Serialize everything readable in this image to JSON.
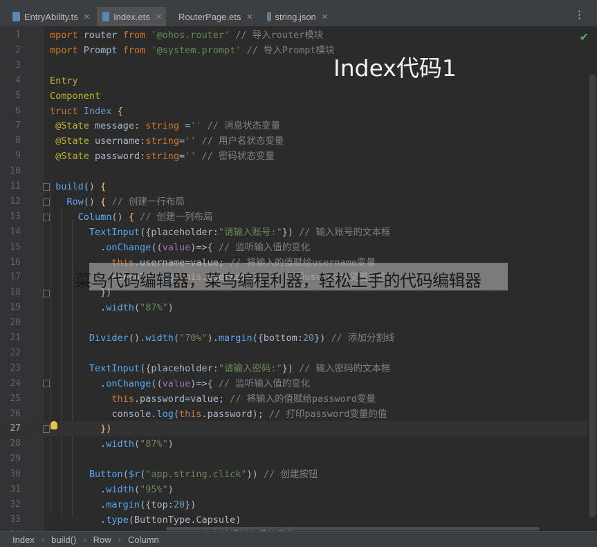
{
  "tabs": [
    {
      "label": "EntryAbility.ts",
      "icon": "typescript-file-icon",
      "active": false
    },
    {
      "label": "Index.ets",
      "icon": "ets-file-icon",
      "active": true
    },
    {
      "label": "RouterPage.ets",
      "icon": "ets-file-icon",
      "active": false
    },
    {
      "label": "string.json",
      "icon": "json-file-icon",
      "active": false
    }
  ],
  "more_menu": "⋮",
  "overlay": {
    "title": "Index代码1",
    "caption": "菜鸟代码编辑器，菜鸟编程利器，轻松上手的代码编辑器"
  },
  "lines": [
    {
      "n": "1",
      "html": "<span class='kw'>mport</span> router <span class='kw'>from</span> <span class='str'>'@ohos.router'</span> <span class='cm'>// 导入router模块</span>"
    },
    {
      "n": "2",
      "html": "<span class='kw'>mport</span> Prompt <span class='kw'>from</span> <span class='str'>'@system.prompt'</span> <span class='cm'>// 导入Prompt模块</span>"
    },
    {
      "n": "3",
      "html": ""
    },
    {
      "n": "4",
      "html": "<span class='ann'>Entry</span>"
    },
    {
      "n": "5",
      "html": "<span class='ann'>Component</span>"
    },
    {
      "n": "6",
      "html": "<span class='kw'>truct</span> <span class='cls'>Index</span> <span class='cn'>{</span>"
    },
    {
      "n": "7",
      "html": " <span class='ann'>@State</span> message: <span class='kw'>string</span> =<span class='str'>''</span> <span class='cm'>// 消息状态变量</span>"
    },
    {
      "n": "8",
      "html": " <span class='ann'>@State</span> username:<span class='kw'>string</span>=<span class='str'>''</span> <span class='cm'>// 用户名状态变量</span>"
    },
    {
      "n": "9",
      "html": " <span class='ann'>@State</span> password:<span class='kw'>string</span>=<span class='str'>''</span> <span class='cm'>// 密码状态变量</span>"
    },
    {
      "n": "10",
      "html": ""
    },
    {
      "n": "11",
      "html": " <span class='fn'>build</span>() <span class='cn'>{</span>"
    },
    {
      "n": "12",
      "html": "   <span class='fn'>Row</span>() <span class='cn'>{</span> <span class='cm'>// 创建一行布局</span>"
    },
    {
      "n": "13",
      "html": "     <span class='fn'>Column</span>() <span class='cn'>{</span> <span class='cm'>// 创建一列布局</span>"
    },
    {
      "n": "14",
      "html": "       <span class='fn'>TextInput</span>({placeholder:<span class='str'>\"请输入账号:\"</span>}) <span class='cm'>// 输入账号的文本框</span>"
    },
    {
      "n": "15",
      "html": "         .<span class='fn'>onChange</span>((<span class='prop'>value</span>)=>{ <span class='cm'>// 监听输入值的变化</span>"
    },
    {
      "n": "16",
      "html": "           <span class='kw'>this</span>.username=value; <span class='cm'>// 将输入的值赋给username变量</span>"
    },
    {
      "n": "17",
      "html": "           console.<span class='fn'>log</span>(<span class='kw'>this</span>.username); <span class='cm'>// 打印username变量的值</span>"
    },
    {
      "n": "18",
      "html": "         })"
    },
    {
      "n": "19",
      "html": "         .<span class='fn'>width</span>(<span class='str'>\"87%\"</span>)"
    },
    {
      "n": "20",
      "html": ""
    },
    {
      "n": "21",
      "html": "       <span class='fn'>Divider</span>().<span class='fn'>width</span>(<span class='str'>\"70%\"</span>).<span class='fn'>margin</span>({bottom:<span class='cls'>20</span>}) <span class='cm'>// 添加分割线</span>"
    },
    {
      "n": "22",
      "html": ""
    },
    {
      "n": "23",
      "html": "       <span class='fn'>TextInput</span>({placeholder:<span class='str'>\"请输入密码:\"</span>}) <span class='cm'>// 输入密码的文本框</span>"
    },
    {
      "n": "24",
      "html": "         .<span class='fn'>onChange</span>((<span class='prop'>value</span>)=>{ <span class='cm'>// 监听输入值的变化</span>"
    },
    {
      "n": "25",
      "html": "           <span class='kw'>this</span>.password=value; <span class='cm'>// 将输入的值赋给password变量</span>"
    },
    {
      "n": "26",
      "html": "           console.<span class='fn'>log</span>(<span class='kw'>this</span>.password); <span class='cm'>// 打印password变量的值</span>"
    },
    {
      "n": "27",
      "html": "         <span class='cn'>})</span>"
    },
    {
      "n": "28",
      "html": "         .<span class='fn'>width</span>(<span class='str'>\"87%\"</span>)"
    },
    {
      "n": "29",
      "html": ""
    },
    {
      "n": "30",
      "html": "       <span class='fn'>Button</span>(<span class='fn'>$r</span>(<span class='str'>\"app.string.click\"</span>)) <span class='cm'>// 创建按钮</span>"
    },
    {
      "n": "31",
      "html": "         .<span class='fn'>width</span>(<span class='str'>\"95%\"</span>)"
    },
    {
      "n": "32",
      "html": "         .<span class='fn'>margin</span>({top:<span class='cls'>20</span>})"
    },
    {
      "n": "33",
      "html": "         .<span class='fn'>type</span>(ButtonType.Capsule)"
    },
    {
      "n": "34",
      "html": "         .<span class='fn'>onClick</span>(()=>{ <span class='cm'>// 点击按钮时执行的事件</span>"
    }
  ],
  "current_line": "27",
  "breadcrumb": [
    "Index",
    "build()",
    "Row",
    "Column"
  ],
  "colors": {
    "keyword": "#cc7832",
    "string": "#6a8759",
    "comment": "#808080",
    "function": "#56a8f5",
    "annotation": "#bbb529",
    "number": "#6897bb",
    "accent": "#4a88c7"
  }
}
